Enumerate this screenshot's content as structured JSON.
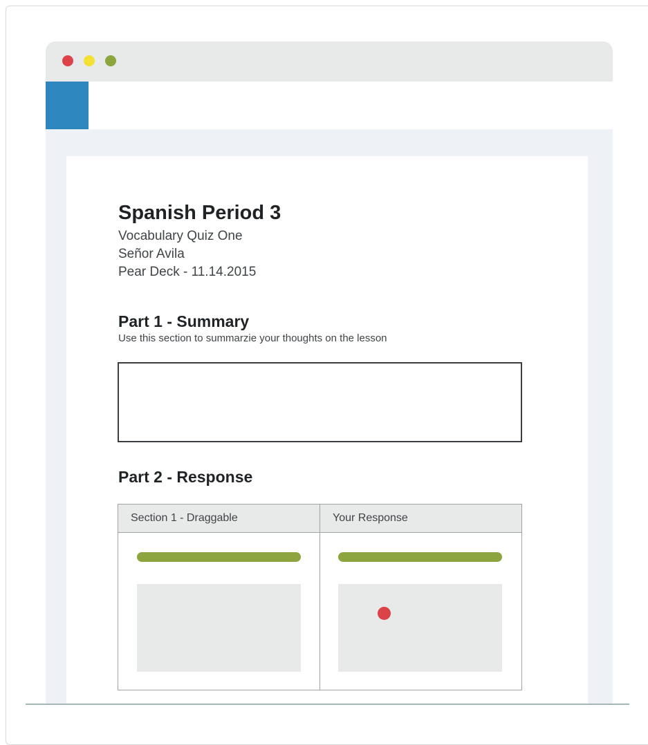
{
  "window": {
    "traffic_lights": {
      "close_color": "#dc4348",
      "minimize_color": "#f2e134",
      "maximize_color": "#8ca53f"
    },
    "brand_color": "#2e86bf"
  },
  "document": {
    "title": "Spanish Period 3",
    "meta": [
      "Vocabulary Quiz One",
      "Señor Avila",
      "Pear Deck - 11.14.2015"
    ],
    "part1": {
      "title": "Part 1 - Summary",
      "description": "Use this section to summarzie your thoughts on the lesson",
      "input_value": ""
    },
    "part2": {
      "title": "Part 2 - Response",
      "columns": [
        "Section 1 - Draggable",
        "Your Response"
      ],
      "accent_color": "#8ca53f",
      "marker_color": "#dc4348"
    }
  }
}
